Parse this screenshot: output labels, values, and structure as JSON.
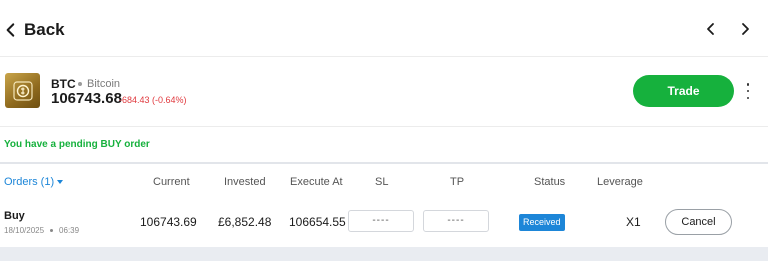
{
  "header": {
    "back_label": "Back",
    "back_icon": "chevron-left-icon",
    "prev_icon": "chevron-left-icon",
    "next_icon": "chevron-right-icon"
  },
  "asset": {
    "ticker": "BTC",
    "name": "Bitcoin",
    "price": "106743.68",
    "change": "-684.43 (-0.64%)",
    "change_color": "#e0393e",
    "trade_label": "Trade",
    "trade_color": "#16b13d",
    "more_icon": "more-vertical-icon"
  },
  "pending_message": "You have a pending BUY order",
  "orders": {
    "tab_label": "Orders (1)",
    "columns": {
      "current": "Current",
      "invested": "Invested",
      "execute_at": "Execute At",
      "sl": "SL",
      "tp": "TP",
      "status": "Status",
      "leverage": "Leverage"
    },
    "rows": [
      {
        "side": "Buy",
        "date": "18/10/2025",
        "time": "06:39",
        "current": "106743.69",
        "invested": "£6,852.48",
        "execute_at": "106654.55",
        "sl": "----",
        "tp": "----",
        "status": "Received",
        "leverage": "X1",
        "action": "Cancel"
      }
    ]
  }
}
